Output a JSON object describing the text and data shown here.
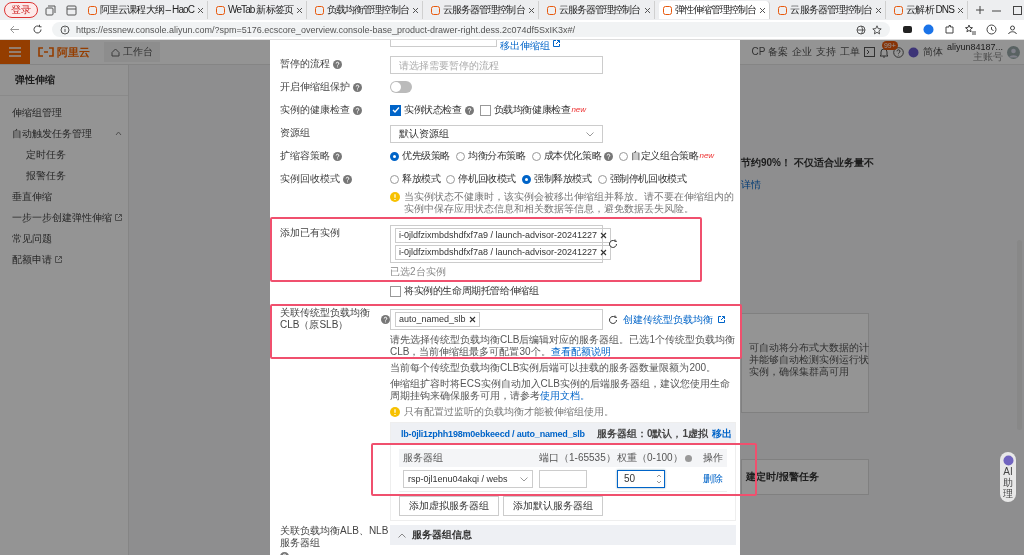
{
  "browser": {
    "profile": "登录",
    "tabs": [
      {
        "title": "阿里云课程大纲 – HaoC",
        "selected": false
      },
      {
        "title": "WeTab 新标签页",
        "selected": false
      },
      {
        "title": "负载均衡管理控制台",
        "selected": false
      },
      {
        "title": "云服务器管理控制台",
        "selected": false
      },
      {
        "title": "云服务器管理控制台",
        "selected": false
      },
      {
        "title": "弹性伸缩管理控制台",
        "selected": true
      },
      {
        "title": "云服务器管理控制台",
        "selected": false
      },
      {
        "title": "云解析 DNS",
        "selected": false
      }
    ],
    "url": "https://essnew.console.aliyun.com/?spm=5176.ecscore_overview.console-base_product-drawer-right.dess.2c074df5SxIK3x#/"
  },
  "console": {
    "logo": "阿里云",
    "workbench": "工作台",
    "nav": [
      "CP 备案",
      "企业",
      "支持",
      "工单"
    ],
    "badge": "99+",
    "language": "简体",
    "user": "aliyun84187...",
    "account_type": "主账号"
  },
  "sidebar": {
    "title": "弹性伸缩",
    "items": [
      {
        "label": "伸缩组管理",
        "external": false
      },
      {
        "label": "自动触发任务管理",
        "external": false,
        "expanded": true,
        "children": [
          {
            "label": "定时任务"
          },
          {
            "label": "报警任务"
          }
        ]
      },
      {
        "label": "垂直伸缩",
        "external": false
      },
      {
        "label": "一步一步创建弹性伸缩",
        "external": true
      },
      {
        "label": "常见问题",
        "external": false
      },
      {
        "label": "配额申请",
        "external": true
      }
    ]
  },
  "background": {
    "promo_text": "节约90%！ 不仅适合业务量不",
    "promo_link": "详情",
    "card_lines": [
      "可自动将分布式大数据的计",
      "并能够自动检测实例运行状",
      "实例，确保集群高可用"
    ],
    "task_card": "建定时/报警任务",
    "assistant": "AI 助理"
  },
  "drawer": {
    "top_link": "移出伸缩组",
    "rows": [
      {
        "kind": "input",
        "label": "暂停的流程",
        "help": true,
        "placeholder": "请选择需要暂停的流程"
      },
      {
        "kind": "switch",
        "label": "开启伸缩组保护",
        "help": true,
        "on": false
      },
      {
        "kind": "checkboxes",
        "label": "实例的健康检查",
        "help": true,
        "options": [
          {
            "label": "实例状态检查",
            "checked": true,
            "help": true
          },
          {
            "label": "负载均衡健康检查",
            "checked": false,
            "help": false,
            "badge": "new"
          }
        ]
      },
      {
        "kind": "select",
        "label": "资源组",
        "help": false,
        "value": "默认资源组"
      },
      {
        "kind": "radios",
        "label": "扩缩容策略",
        "help": true,
        "options": [
          {
            "label": "优先级策略",
            "selected": true,
            "help": false
          },
          {
            "label": "均衡分布策略",
            "selected": false,
            "help": false
          },
          {
            "label": "成本优化策略",
            "selected": false,
            "help": true
          },
          {
            "label": "自定义组合策略",
            "selected": false,
            "help": false,
            "badge": "new"
          }
        ]
      },
      {
        "kind": "radios",
        "label": "实例回收模式",
        "help": true,
        "options": [
          {
            "label": "释放模式",
            "selected": false,
            "help": false
          },
          {
            "label": "停机回收模式",
            "selected": false,
            "help": false
          },
          {
            "label": "强制释放模式",
            "selected": true,
            "help": false
          },
          {
            "label": "强制停机回收模式",
            "selected": false,
            "help": false
          }
        ],
        "warning": "当实例状态不健康时，该实例会被移出伸缩组并释放。请不要在伸缩组内的实例中保存应用状态信息和相关数据等信息，避免数据丢失风险。"
      },
      {
        "kind": "tags",
        "label": "添加已有实例",
        "help": false,
        "highlighted": true,
        "tags": [
          "i-0jldfzixmbdshdfxf7a9 / launch-advisor-20241227",
          "i-0jldfzixmbdshdfxf7a8 / launch-advisor-20241227"
        ],
        "note": "已选2台实例"
      },
      {
        "kind": "checkbox",
        "text": "将实例的生命周期托管给伸缩组",
        "checked": false
      },
      {
        "kind": "clb",
        "label": "关联传统型负载均衡CLB（原SLB）",
        "help": true,
        "highlighted": true,
        "tags": [
          "auto_named_slb"
        ],
        "link": "创建传统型负载均衡",
        "notes": [
          {
            "text": "请先选择传统型负载均衡CLB后编辑对应的服务器组。已选1个传统型负载均衡CLB，当前伸缩组最多可配置30个。",
            "link": "查看配额说明"
          },
          {
            "text": "当前每个传统型负载均衡CLB实例后端可以挂载的服务器数量限额为200。"
          },
          {
            "text": "伸缩组扩容时将ECS实例自动加入CLB实例的后端服务器组，建议您使用生命周期挂钩来确保服务可用，请参考",
            "link": "使用文档。"
          }
        ],
        "warning": "只有配置过监听的负载均衡才能被伸缩组使用。"
      }
    ],
    "lb_panel": {
      "title": "lb-0jli1zphh198m0ebkeecd / auto_named_slb",
      "summary": "服务器组：0默认，1虚拟",
      "action": "移出",
      "expanded": true,
      "table": {
        "highlighted": true,
        "columns": [
          {
            "label": "服务器组"
          },
          {
            "label": "端口（1-65535）"
          },
          {
            "label": "权重（0-100）",
            "help": true
          },
          {
            "label": "操作"
          }
        ],
        "rows": [
          {
            "group": "rsp-0jl1enu04akqi / webs",
            "weight": "50",
            "action": "删除"
          }
        ]
      },
      "buttons": [
        "添加虚拟服务器组",
        "添加默认服务器组"
      ]
    },
    "alb_row": {
      "label": "关联负载均衡ALB、NLB服务器组",
      "help": true,
      "panel_title": "服务器组信息",
      "expanded": false
    }
  }
}
